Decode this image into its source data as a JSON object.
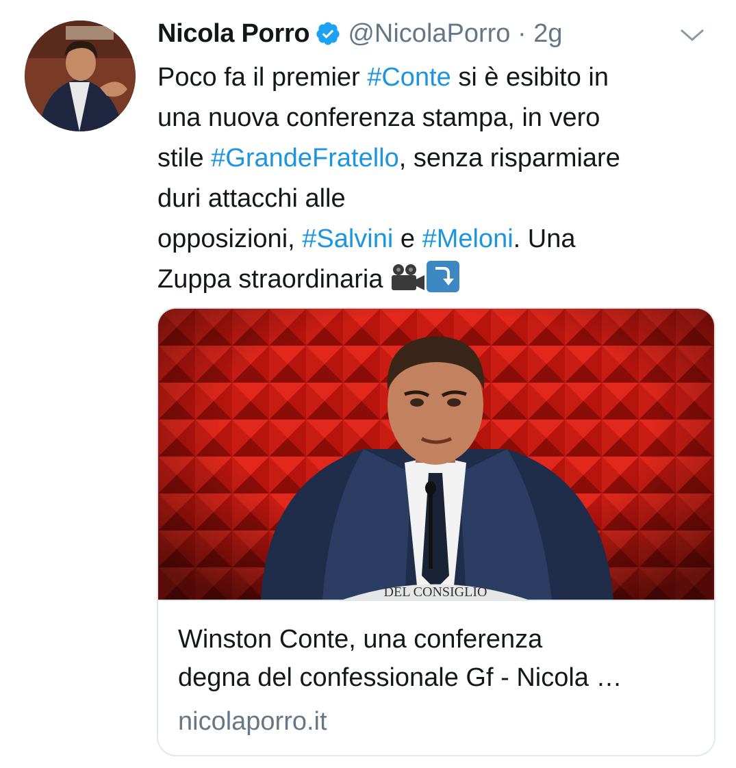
{
  "tweet": {
    "author_name": "Nicola Porro",
    "handle_and_time": "@NicolaPorro · 2g",
    "text_parts": [
      {
        "t": "Poco fa il premier ",
        "h": false
      },
      {
        "t": "#Conte",
        "h": true
      },
      {
        "t": " si è esibito in\nuna nuova conferenza stampa, in vero\nstile ",
        "h": false
      },
      {
        "t": "#GrandeFratello",
        "h": true
      },
      {
        "t": ", senza risparmiare\nduri attacchi alle\nopposizioni, ",
        "h": false
      },
      {
        "t": "#Salvini",
        "h": true
      },
      {
        "t": " e ",
        "h": false
      },
      {
        "t": "#Meloni",
        "h": true
      },
      {
        "t": ". Una\nZuppa straordinaria ",
        "h": false
      }
    ],
    "emojis": [
      "video-camera-icon",
      "arrow-down-right-icon"
    ]
  },
  "card": {
    "title_line1": "Winston Conte, una conferenza",
    "title_line2": "degna del confessionale Gf - Nicola …",
    "domain": "nicolaporro.it",
    "image_caption": "DEL CONSIGLIO"
  },
  "colors": {
    "hashtag": "#1b95e0",
    "verified": "#1da1f2",
    "secondary_text": "#657786",
    "card_border": "#e1e8ed",
    "card_image_bg": "#c41a12"
  }
}
